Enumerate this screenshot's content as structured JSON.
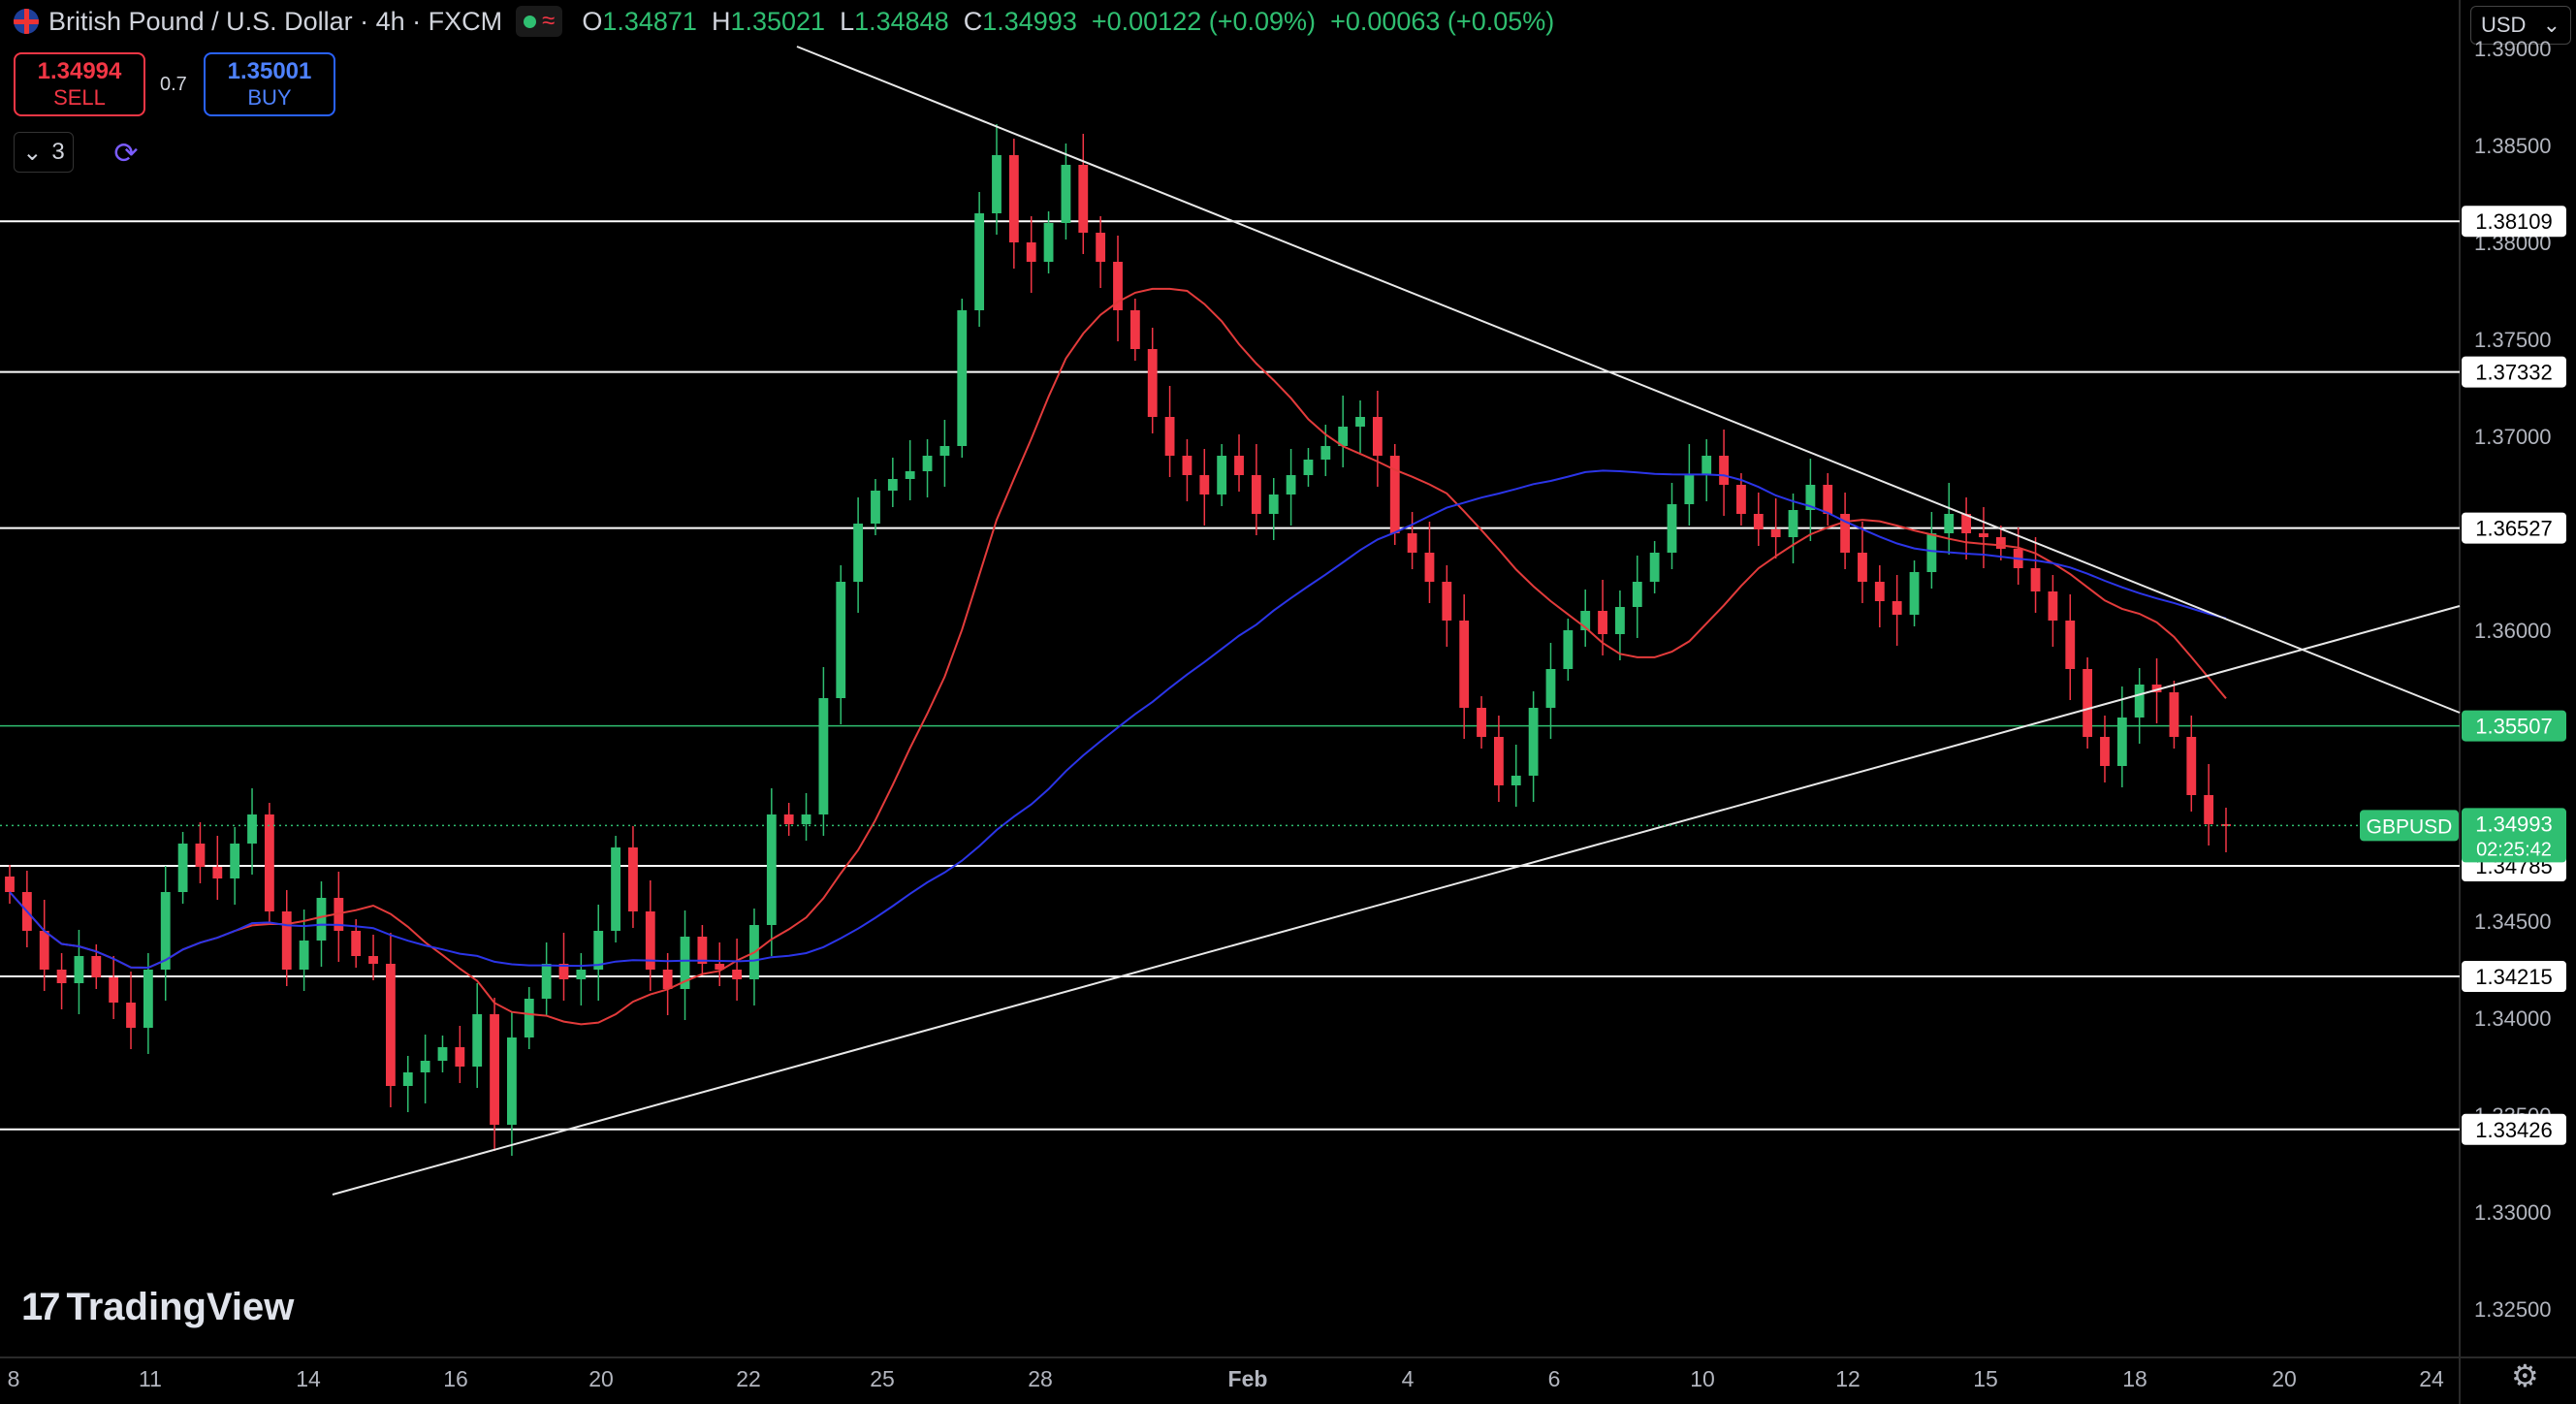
{
  "header": {
    "title": "British Pound / U.S. Dollar · 4h · FXCM",
    "ohlc": [
      {
        "k": "O",
        "v": "1.34871"
      },
      {
        "k": "H",
        "v": "1.35021"
      },
      {
        "k": "L",
        "v": "1.34848"
      },
      {
        "k": "C",
        "v": "1.34993"
      }
    ],
    "change": "+0.00122 (+0.09%)",
    "change2": "+0.00063 (+0.05%)"
  },
  "trade": {
    "sell_price": "1.34994",
    "sell_label": "SELL",
    "spread": "0.7",
    "buy_price": "1.35001",
    "buy_label": "BUY"
  },
  "toolbar": {
    "count": "3"
  },
  "currency": "USD",
  "logo_text": "TradingView",
  "colors": {
    "up": "#2fbf71",
    "down": "#f23645",
    "ma_fast": "#e33b3b",
    "ma_slow": "#2b35e8"
  },
  "chart_data": {
    "type": "candlestick",
    "symbol": "GBPUSD",
    "last_price": "1.34993",
    "countdown": "02:25:42",
    "ylim": [
      1.3225,
      1.3925
    ],
    "y_ticks": [
      "1.39000",
      "1.38500",
      "1.38000",
      "1.37500",
      "1.37000",
      "1.36500",
      "1.36000",
      "1.35500",
      "1.35000",
      "1.34500",
      "1.34000",
      "1.33500",
      "1.33000",
      "1.32500"
    ],
    "x_ticks": [
      "8",
      "11",
      "14",
      "16",
      "20",
      "22",
      "25",
      "28",
      "Feb",
      "4",
      "6",
      "10",
      "12",
      "15",
      "18",
      "20",
      "24"
    ],
    "horizontal_levels": [
      {
        "label": "1.38109",
        "value": 1.38109,
        "color": "#ffffff"
      },
      {
        "label": "1.37332",
        "value": 1.37332,
        "color": "#ffffff"
      },
      {
        "label": "1.36527",
        "value": 1.36527,
        "color": "#ffffff"
      },
      {
        "label": "1.35507",
        "value": 1.35507,
        "color": "#2fbf71"
      },
      {
        "label": "1.34785",
        "value": 1.34785,
        "color": "#ffffff"
      },
      {
        "label": "1.34215",
        "value": 1.34215,
        "color": "#ffffff"
      },
      {
        "label": "1.33426",
        "value": 1.33426,
        "color": "#ffffff"
      }
    ],
    "series": [
      {
        "kind": "close_path",
        "values": [
          1.3465,
          1.3445,
          1.3425,
          1.3418,
          1.3432,
          1.3421,
          1.3408,
          1.3395,
          1.3425,
          1.3465,
          1.349,
          1.3478,
          1.3472,
          1.349,
          1.3505,
          1.3455,
          1.3425,
          1.344,
          1.3462,
          1.3445,
          1.3432,
          1.3428,
          1.3365,
          1.3372,
          1.3378,
          1.3385,
          1.3375,
          1.3402,
          1.3345,
          1.339,
          1.341,
          1.3428,
          1.342,
          1.3425,
          1.3445,
          1.3488,
          1.3455,
          1.3425,
          1.3415,
          1.3442,
          1.3428,
          1.3425,
          1.342,
          1.3448,
          1.3505,
          1.35,
          1.3505,
          1.3565,
          1.3625,
          1.3655,
          1.3672,
          1.3678,
          1.3682,
          1.369,
          1.3695,
          1.3765,
          1.3815,
          1.3845,
          1.38,
          1.379,
          1.381,
          1.384,
          1.3805,
          1.379,
          1.3765,
          1.3745,
          1.371,
          1.369,
          1.368,
          1.367,
          1.369,
          1.368,
          1.366,
          1.367,
          1.368,
          1.3688,
          1.3695,
          1.3705,
          1.371,
          1.369,
          1.365,
          1.364,
          1.3625,
          1.3605,
          1.356,
          1.3545,
          1.352,
          1.3525,
          1.356,
          1.358,
          1.36,
          1.361,
          1.3598,
          1.3612,
          1.3625,
          1.364,
          1.3665,
          1.368,
          1.369,
          1.3675,
          1.366,
          1.3652,
          1.3648,
          1.3662,
          1.3675,
          1.366,
          1.364,
          1.3625,
          1.3615,
          1.3608,
          1.363,
          1.365,
          1.366,
          1.365,
          1.3648,
          1.3642,
          1.3632,
          1.362,
          1.3605,
          1.358,
          1.3545,
          1.353,
          1.3555,
          1.3572,
          1.3568,
          1.3545,
          1.3515,
          1.35,
          1.3499
        ]
      },
      {
        "kind": "ma",
        "name": "",
        "color": "#e33b3b"
      },
      {
        "kind": "ma",
        "name": "",
        "color": "#2b35e8"
      }
    ],
    "trendlines": [
      {
        "from": {
          "x": "21",
          "y": 1.392
        },
        "to": {
          "x": "24",
          "y": 1.3565
        }
      },
      {
        "from": {
          "x": "13",
          "y": 1.3315
        },
        "to": {
          "x": "24",
          "y": 1.362
        }
      }
    ]
  }
}
